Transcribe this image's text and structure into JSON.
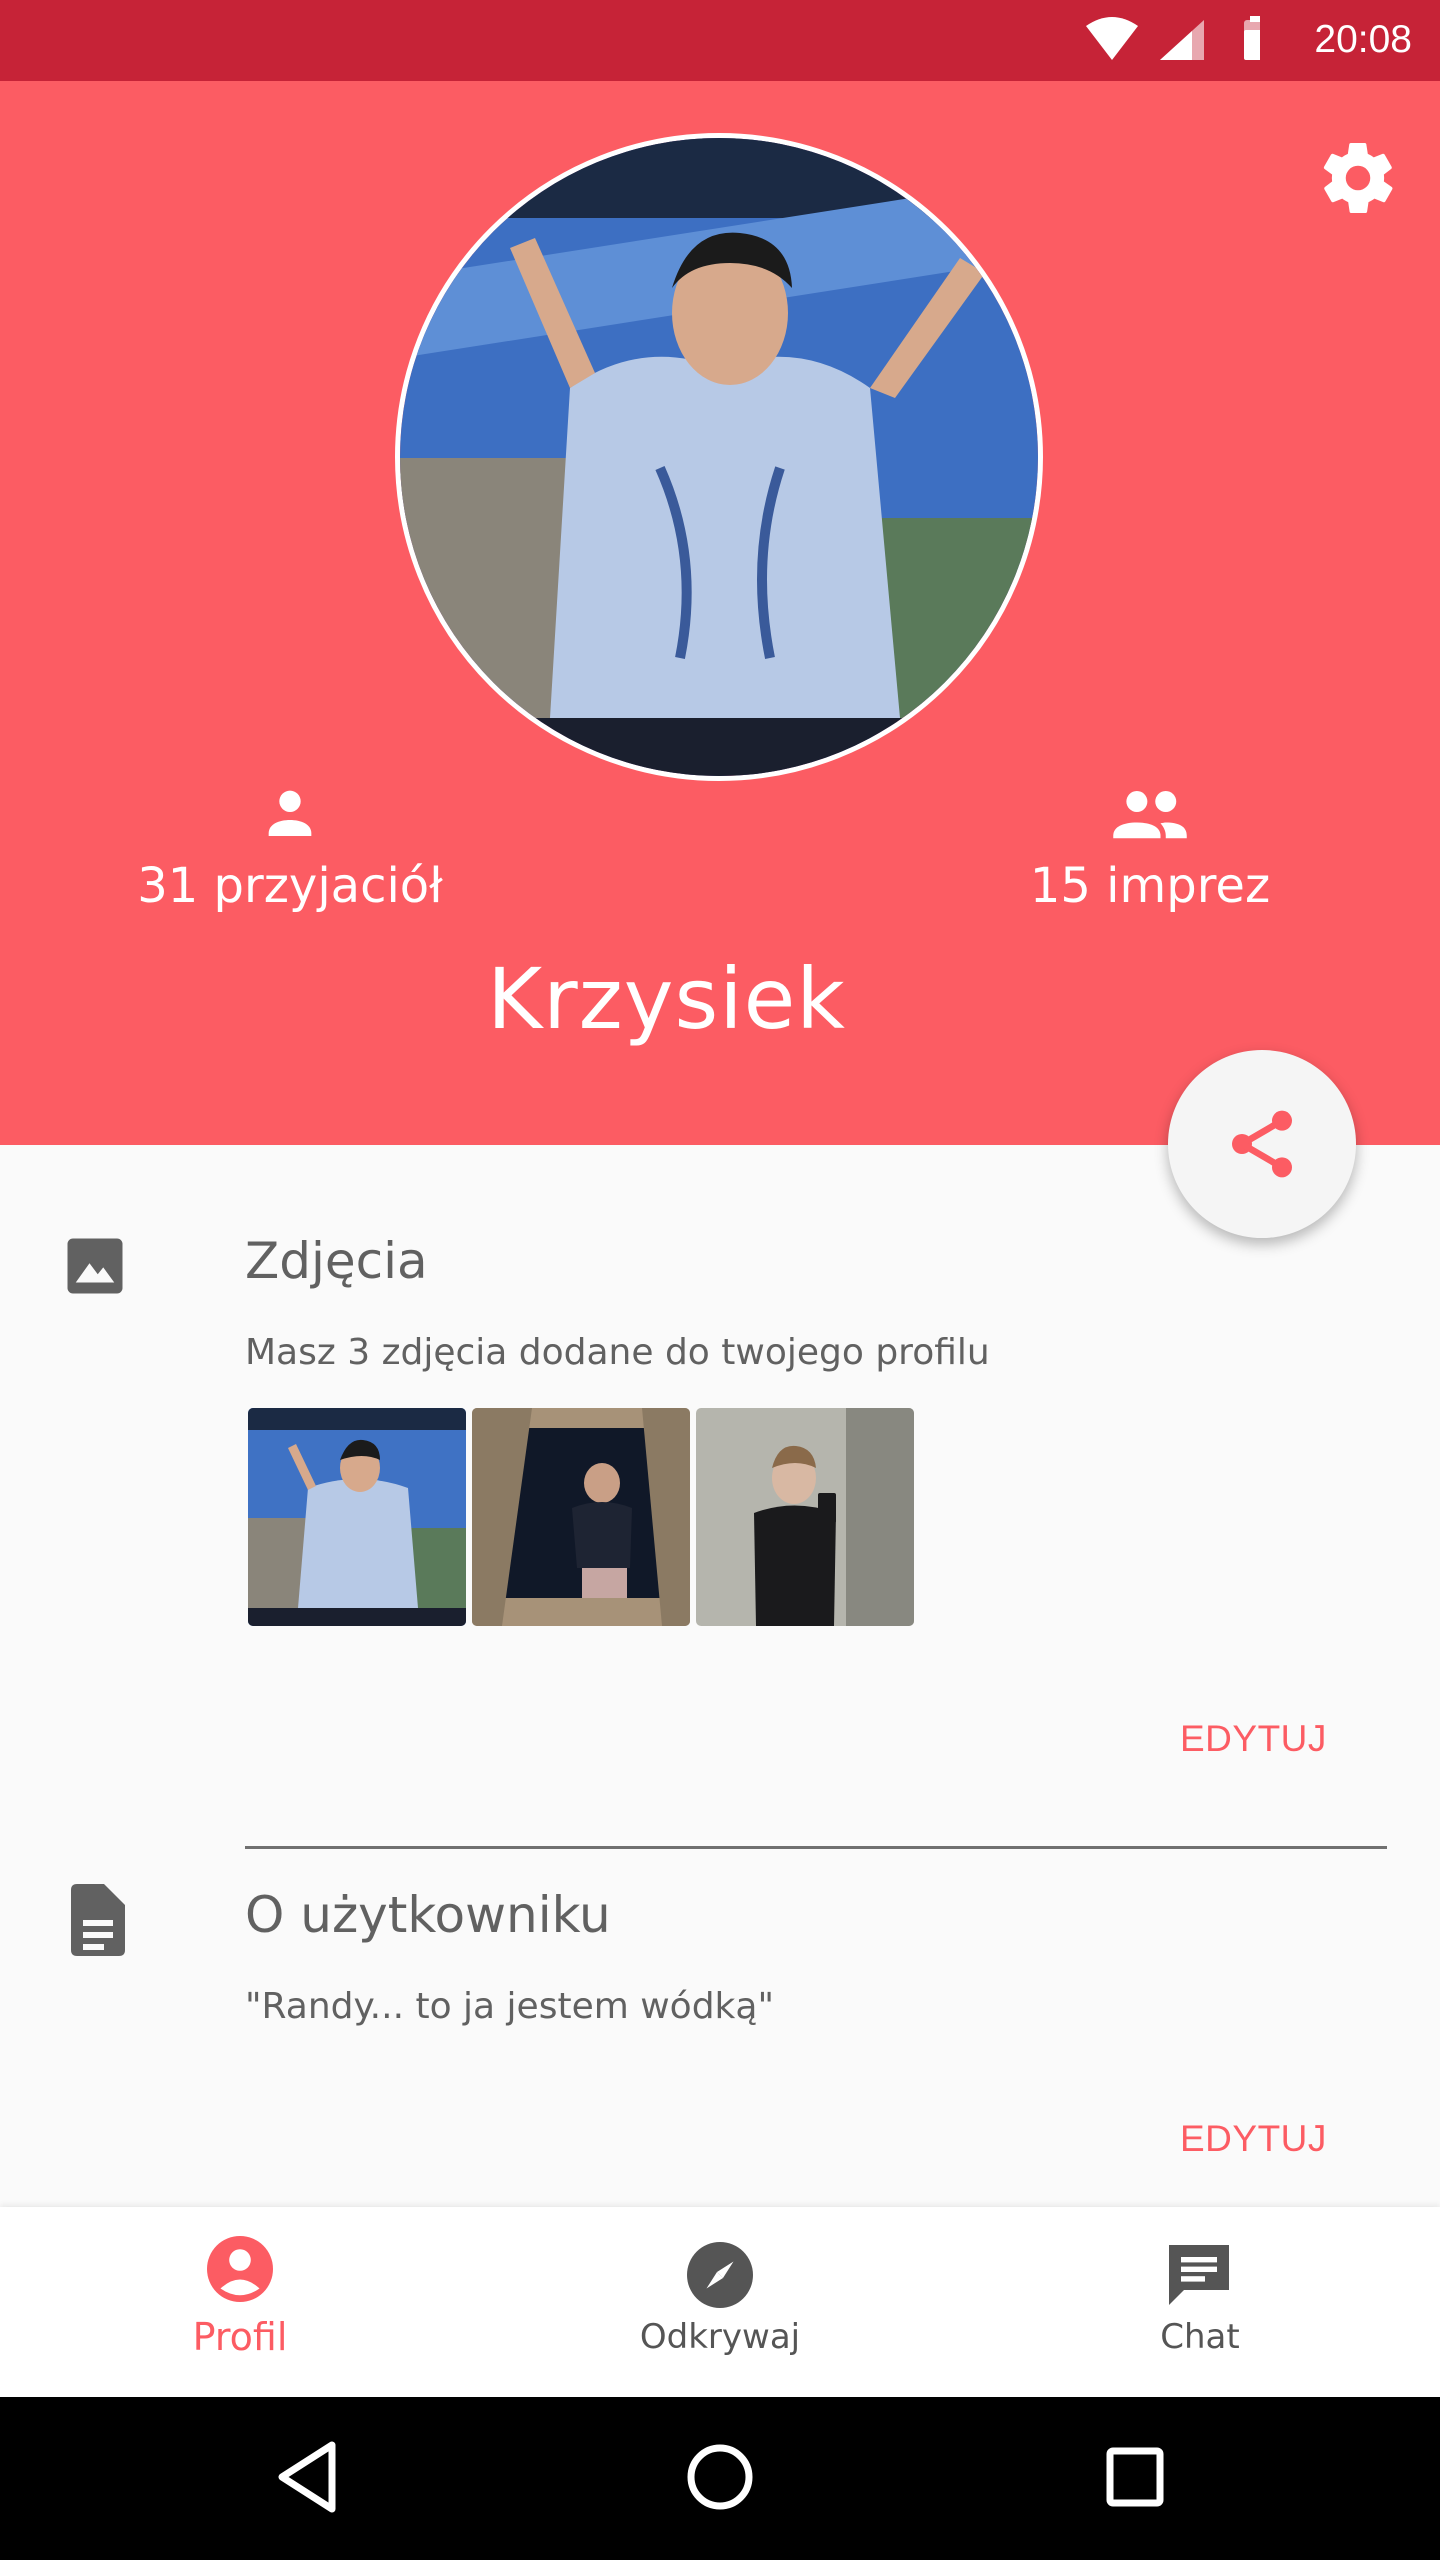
{
  "status_bar": {
    "time": "20:08"
  },
  "header": {
    "username": "Krzysiek",
    "friends_label": "31 przyjaciół",
    "parties_label": "15 imprez"
  },
  "photos_section": {
    "title": "Zdjęcia",
    "description": "Masz 3 zdjęcia dodane do twojego profilu",
    "edit_label": "EDYTUJ"
  },
  "about_section": {
    "title": "O użytkowniku",
    "text": "\"Randy... to ja jestem wódką\"",
    "edit_label": "EDYTUJ"
  },
  "bottom_nav": {
    "items": [
      {
        "label": "Profil",
        "icon": "account-circle-icon",
        "active": true
      },
      {
        "label": "Odkrywaj",
        "icon": "compass-icon",
        "active": false
      },
      {
        "label": "Chat",
        "icon": "chat-icon",
        "active": false
      }
    ]
  },
  "colors": {
    "status_bar": "#c62337",
    "brand": "#fc5c63",
    "background": "#fafafa"
  }
}
